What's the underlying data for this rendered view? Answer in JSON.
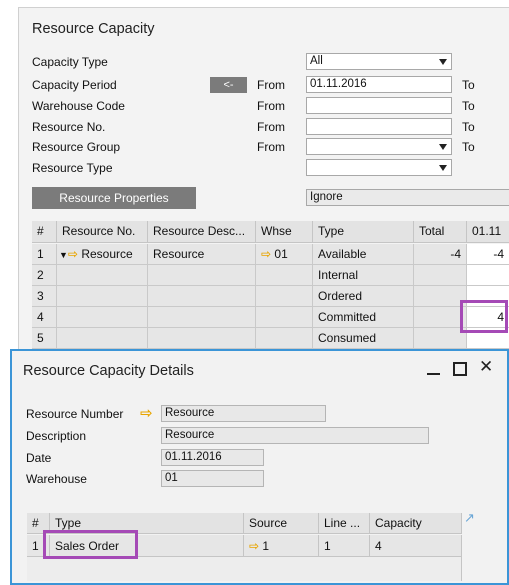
{
  "capacity_window": {
    "title": "Resource Capacity",
    "fields": {
      "capacity_type": {
        "label": "Capacity Type",
        "value": "All"
      },
      "capacity_period": {
        "label": "Capacity Period",
        "button": "<-",
        "from_label": "From",
        "from_value": "01.11.2016",
        "to_label": "To"
      },
      "warehouse_code": {
        "label": "Warehouse Code",
        "from_label": "From",
        "to_label": "To"
      },
      "resource_no": {
        "label": "Resource No.",
        "from_label": "From",
        "to_label": "To"
      },
      "resource_group": {
        "label": "Resource Group",
        "from_label": "From",
        "to_label": "To"
      },
      "resource_type": {
        "label": "Resource Type"
      }
    },
    "resource_properties_button": "Resource Properties",
    "properties_value": "Ignore",
    "grid": {
      "columns": [
        "#",
        "Resource No.",
        "Resource Desc...",
        "Whse",
        "Type",
        "Total",
        "01.11"
      ],
      "rows": [
        {
          "num": "1",
          "resource_no": "Resource",
          "resource_desc": "Resource",
          "whse": "01",
          "type": "Available",
          "total": "-4",
          "day": "-4"
        },
        {
          "num": "2",
          "type": "Internal"
        },
        {
          "num": "3",
          "type": "Ordered"
        },
        {
          "num": "4",
          "type": "Committed",
          "day": "4"
        },
        {
          "num": "5",
          "type": "Consumed"
        }
      ]
    }
  },
  "details_window": {
    "title": "Resource Capacity Details",
    "fields": {
      "resource_number": {
        "label": "Resource Number",
        "value": "Resource"
      },
      "description": {
        "label": "Description",
        "value": "Resource"
      },
      "date": {
        "label": "Date",
        "value": "01.11.2016"
      },
      "warehouse": {
        "label": "Warehouse",
        "value": "01"
      }
    },
    "grid": {
      "columns": [
        "#",
        "Type",
        "Source",
        "Line ...",
        "Capacity"
      ],
      "rows": [
        {
          "num": "1",
          "type": "Sales Order",
          "source": "1",
          "line": "1",
          "capacity": "4"
        }
      ]
    }
  },
  "colors": {
    "highlight": "#a54ab6",
    "window_border": "#3b95d7",
    "link_arrow": "#e8a500",
    "dark_button": "#7b7b7b"
  },
  "icons": [
    "dropdown-arrow-icon",
    "link-arrow-icon",
    "expand-triangle-icon",
    "minimize-icon",
    "maximize-icon",
    "close-icon",
    "expand-grid-icon"
  ]
}
